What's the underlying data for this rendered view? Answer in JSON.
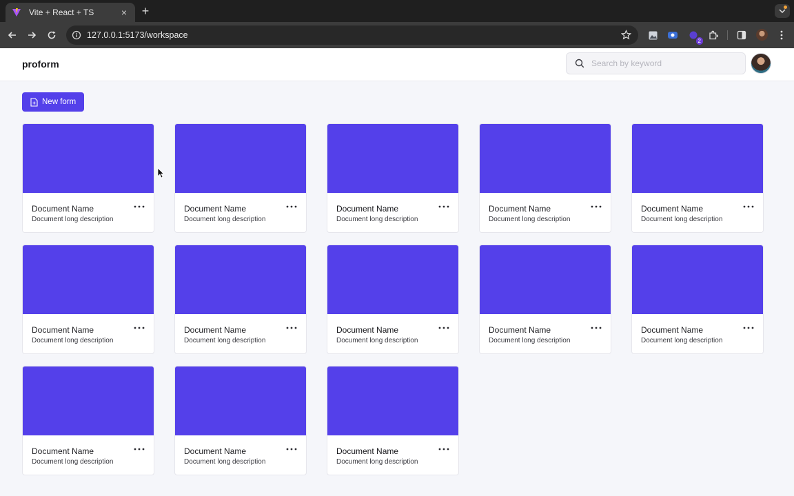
{
  "browser": {
    "tab_title": "Vite + React + TS",
    "tab_close": "×",
    "new_tab": "+",
    "url": "127.0.0.1:5173/workspace",
    "extension_badge": "2"
  },
  "header": {
    "brand": "proform",
    "search_placeholder": "Search by keyword"
  },
  "toolbar": {
    "new_form_label": "New form"
  },
  "colors": {
    "accent": "#5440ea",
    "page_bg": "#f5f6fa"
  },
  "cards": [
    {
      "name": "Document Name",
      "description": "Document long description"
    },
    {
      "name": "Document Name",
      "description": "Document long description"
    },
    {
      "name": "Document Name",
      "description": "Document long description"
    },
    {
      "name": "Document Name",
      "description": "Document long description"
    },
    {
      "name": "Document Name",
      "description": "Document long description"
    },
    {
      "name": "Document Name",
      "description": "Document long description"
    },
    {
      "name": "Document Name",
      "description": "Document long description"
    },
    {
      "name": "Document Name",
      "description": "Document long description"
    },
    {
      "name": "Document Name",
      "description": "Document long description"
    },
    {
      "name": "Document Name",
      "description": "Document long description"
    },
    {
      "name": "Document Name",
      "description": "Document long description"
    },
    {
      "name": "Document Name",
      "description": "Document long description"
    },
    {
      "name": "Document Name",
      "description": "Document long description"
    }
  ]
}
